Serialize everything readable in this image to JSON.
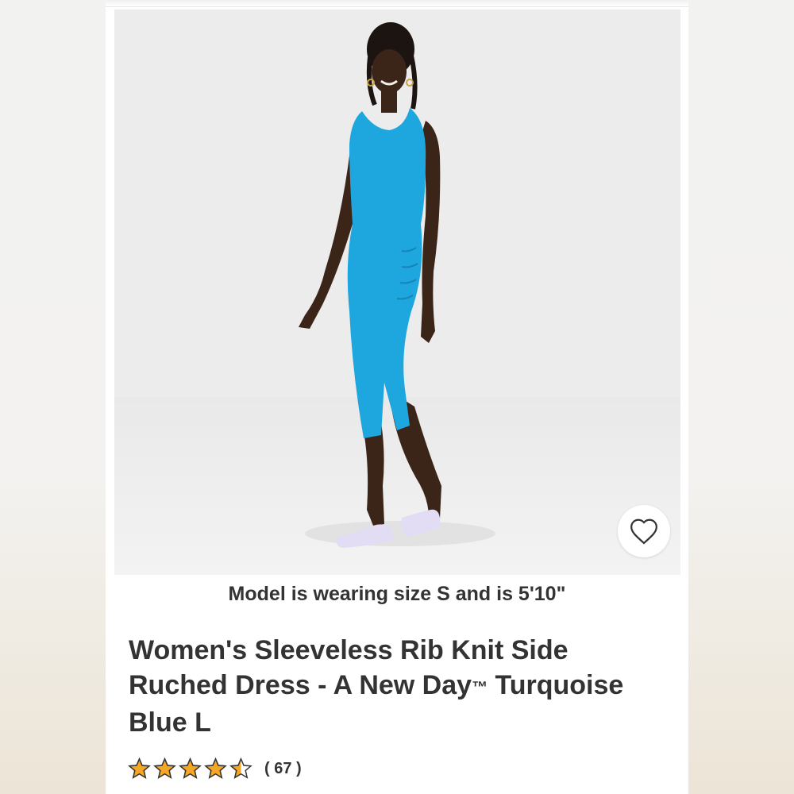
{
  "image": {
    "alt": "Model in turquoise sleeveless rib knit dress"
  },
  "favorite": {
    "icon": "heart-outline-icon"
  },
  "caption": "Model is wearing size S and is 5'10\"",
  "product": {
    "title_part1": "Women's Sleeveless Rib Knit Side Ruched Dress - A New Day",
    "trademark": "™",
    "title_part2": " Turquoise Blue L"
  },
  "rating": {
    "stars": 4.5,
    "max": 5,
    "count_text": "( 67 )",
    "star_color": "#f5a623"
  },
  "colors": {
    "dress": "#1ea7de",
    "text": "#333333"
  }
}
